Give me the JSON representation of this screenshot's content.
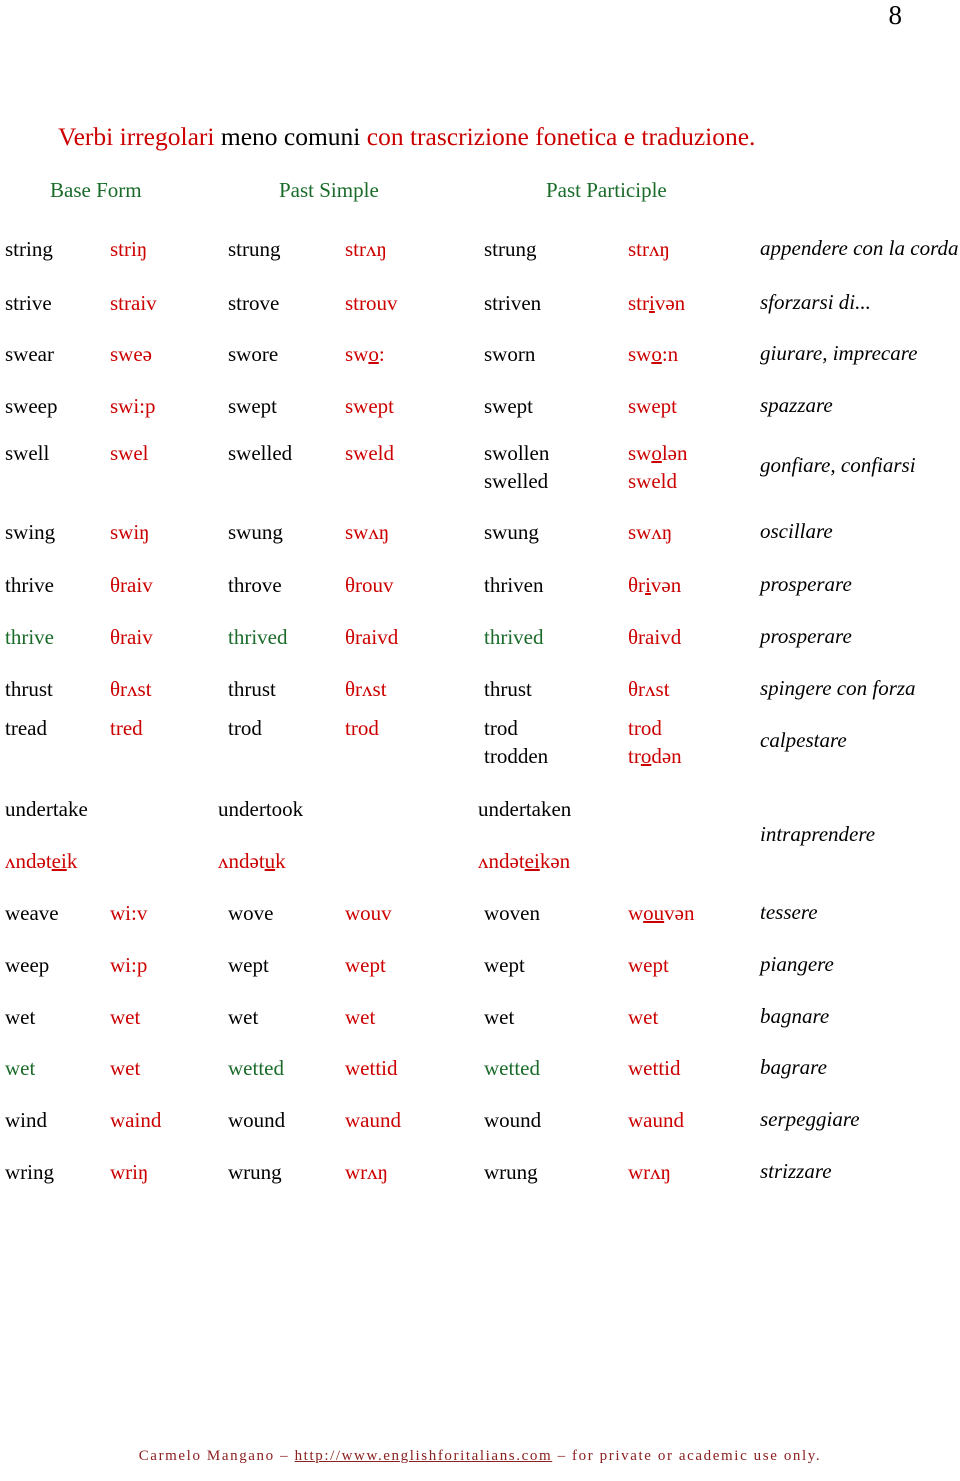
{
  "page_number": "8",
  "title": {
    "segments": [
      {
        "text": "Verbi  irregolari ",
        "color": "#cc0000"
      },
      {
        "text": " meno comuni ",
        "color": "#000000"
      },
      {
        "text": "con trascrizione fonetica e traduzione.",
        "color": "#cc0000"
      }
    ],
    "plain": "Verbi irregolari meno comuni con trascrizione fonetica e traduzione."
  },
  "headers": {
    "base_form": "Base Form",
    "past_simple": "Past Simple",
    "past_participle": "Past Participle",
    "color": "#1a6b2a"
  },
  "colors": {
    "phonetic": "#cc0000",
    "english": "#000000",
    "english_alt": "#1a6b2a",
    "header": "#1a6b2a",
    "title_accent": "#cc0000",
    "footer": "#8b2020"
  },
  "rows": [
    {
      "base": [
        "string"
      ],
      "base_phon": [
        "striŋ"
      ],
      "past": [
        "strung"
      ],
      "past_phon": [
        "strʌŋ"
      ],
      "part": [
        "strung"
      ],
      "part_phon": [
        "strʌŋ"
      ],
      "translation": "appendere con la corda",
      "eng_color": "#000000"
    },
    {
      "base": [
        "strive"
      ],
      "base_phon": [
        "straiv"
      ],
      "past": [
        "strove"
      ],
      "past_phon": [
        "strouv"
      ],
      "part": [
        "striven"
      ],
      "part_phon": [
        "strivən"
      ],
      "translation": "sforzarsi di...",
      "eng_color": "#000000"
    },
    {
      "base": [
        "swear"
      ],
      "base_phon": [
        "sweə"
      ],
      "past": [
        "swore"
      ],
      "past_phon": [
        "swo:"
      ],
      "part": [
        "sworn"
      ],
      "part_phon": [
        "swo:n"
      ],
      "translation": "giurare, imprecare",
      "eng_color": "#000000"
    },
    {
      "base": [
        "sweep"
      ],
      "base_phon": [
        "swi:p"
      ],
      "past": [
        "swept"
      ],
      "past_phon": [
        "swept"
      ],
      "part": [
        "swept"
      ],
      "part_phon": [
        "swept"
      ],
      "translation": "spazzare",
      "eng_color": "#000000"
    },
    {
      "base": [
        "swell"
      ],
      "base_phon": [
        "swel"
      ],
      "past": [
        "swelled"
      ],
      "past_phon": [
        "sweld"
      ],
      "part": [
        "swollen",
        "swelled"
      ],
      "part_phon": [
        "swolən",
        "sweld"
      ],
      "translation": "gonfiare, confiarsi",
      "eng_color": "#000000"
    },
    {
      "base": [
        "swing"
      ],
      "base_phon": [
        "swiŋ"
      ],
      "past": [
        "swung"
      ],
      "past_phon": [
        "swʌŋ"
      ],
      "part": [
        "swung"
      ],
      "part_phon": [
        "swʌŋ"
      ],
      "translation": "oscillare",
      "eng_color": "#000000"
    },
    {
      "base": [
        "thrive"
      ],
      "base_phon": [
        "θraiv"
      ],
      "past": [
        "throve"
      ],
      "past_phon": [
        "θrouv"
      ],
      "part": [
        "thriven"
      ],
      "part_phon": [
        "θrivən"
      ],
      "translation": "prosperare",
      "eng_color": "#000000"
    },
    {
      "base": [
        "thrive"
      ],
      "base_phon": [
        "θraiv"
      ],
      "past": [
        "thrived"
      ],
      "past_phon": [
        "θraivd"
      ],
      "part": [
        "thrived"
      ],
      "part_phon": [
        "θraivd"
      ],
      "translation": "prosperare",
      "eng_color": "#1a6b2a"
    },
    {
      "base": [
        "thrust"
      ],
      "base_phon": [
        "θrʌst"
      ],
      "past": [
        "thrust"
      ],
      "past_phon": [
        "θrʌst"
      ],
      "part": [
        "thrust"
      ],
      "part_phon": [
        "θrʌst"
      ],
      "translation": "spingere con forza",
      "eng_color": "#000000"
    },
    {
      "base": [
        "tread"
      ],
      "base_phon": [
        "tred"
      ],
      "past": [
        "trod"
      ],
      "past_phon": [
        "trod"
      ],
      "part": [
        "trod",
        "trodden"
      ],
      "part_phon": [
        "trod",
        "trodən"
      ],
      "translation": "calpestare",
      "eng_color": "#000000"
    },
    {
      "base": [
        "undertake"
      ],
      "base_phon": [
        "ʌndəteik"
      ],
      "past": [
        "undertook"
      ],
      "past_phon": [
        "ʌndətuk"
      ],
      "part": [
        "undertaken"
      ],
      "part_phon": [
        "ʌndəteikən"
      ],
      "translation": "intraprendere",
      "eng_color": "#000000",
      "stacked": true
    },
    {
      "base": [
        "weave"
      ],
      "base_phon": [
        "wi:v"
      ],
      "past": [
        "wove"
      ],
      "past_phon": [
        "wouv"
      ],
      "part": [
        "woven"
      ],
      "part_phon": [
        "wouvən"
      ],
      "translation": "tessere",
      "eng_color": "#000000"
    },
    {
      "base": [
        "weep"
      ],
      "base_phon": [
        "wi:p"
      ],
      "past": [
        "wept"
      ],
      "past_phon": [
        "wept"
      ],
      "part": [
        "wept"
      ],
      "part_phon": [
        "wept"
      ],
      "translation": "piangere",
      "eng_color": "#000000"
    },
    {
      "base": [
        "wet"
      ],
      "base_phon": [
        "wet"
      ],
      "past": [
        "wet"
      ],
      "past_phon": [
        "wet"
      ],
      "part": [
        "wet"
      ],
      "part_phon": [
        "wet"
      ],
      "translation": "bagnare",
      "eng_color": "#000000"
    },
    {
      "base": [
        "wet"
      ],
      "base_phon": [
        "wet"
      ],
      "past": [
        "wetted"
      ],
      "past_phon": [
        "wettid"
      ],
      "part": [
        "wetted"
      ],
      "part_phon": [
        "wettid"
      ],
      "translation": "bagrare",
      "eng_color": "#1a6b2a"
    },
    {
      "base": [
        "wind"
      ],
      "base_phon": [
        "waind"
      ],
      "past": [
        "wound"
      ],
      "past_phon": [
        "waund"
      ],
      "part": [
        "wound"
      ],
      "part_phon": [
        "waund"
      ],
      "translation": "serpeggiare",
      "eng_color": "#000000"
    },
    {
      "base": [
        "wring"
      ],
      "base_phon": [
        "wriŋ"
      ],
      "past": [
        "wrung"
      ],
      "past_phon": [
        "wrʌŋ"
      ],
      "part": [
        "wrung"
      ],
      "part_phon": [
        "wrʌŋ"
      ],
      "translation": "strizzare",
      "eng_color": "#000000"
    }
  ],
  "footer": {
    "author": "Carmelo Mangano",
    "dash1": " – ",
    "url": "http://www.englishforitalians.com",
    "dash2": " – ",
    "notice": "for private or academic use only.",
    "full": "Carmelo Mangano – http://www.englishforitalians.com – for private or academic use only."
  }
}
